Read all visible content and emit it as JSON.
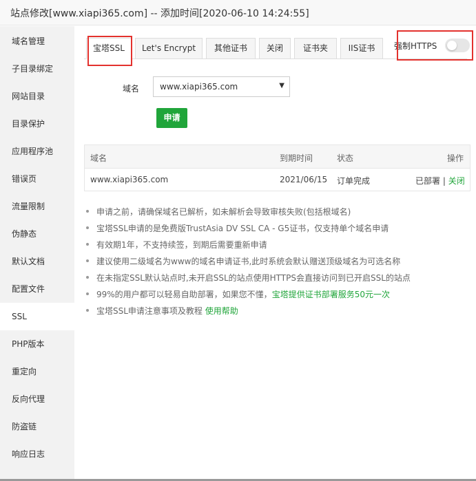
{
  "window": {
    "title": "站点修改[www.xiapi365.com] -- 添加时间[2020-06-10 14:24:55]"
  },
  "sidebar": {
    "items": [
      {
        "label": "域名管理"
      },
      {
        "label": "子目录绑定"
      },
      {
        "label": "网站目录"
      },
      {
        "label": "目录保护"
      },
      {
        "label": "应用程序池"
      },
      {
        "label": "错误页"
      },
      {
        "label": "流量限制"
      },
      {
        "label": "伪静态"
      },
      {
        "label": "默认文档"
      },
      {
        "label": "配置文件"
      },
      {
        "label": "SSL"
      },
      {
        "label": "PHP版本"
      },
      {
        "label": "重定向"
      },
      {
        "label": "反向代理"
      },
      {
        "label": "防盗链"
      },
      {
        "label": "响应日志"
      }
    ],
    "active_index": 10
  },
  "tabs": [
    {
      "label": "宝塔SSL",
      "active": true
    },
    {
      "label": "Let's Encrypt"
    },
    {
      "label": "其他证书"
    },
    {
      "label": "关闭"
    },
    {
      "label": "证书夹"
    },
    {
      "label": "IIS证书"
    }
  ],
  "force_https": {
    "label": "强制HTTPS",
    "enabled": false
  },
  "form": {
    "domain_label": "域名",
    "domain_value": "www.xiapi365.com",
    "domain_caret": "▼",
    "apply_label": "申请"
  },
  "table": {
    "headers": [
      "域名",
      "到期时间",
      "状态",
      "操作"
    ],
    "rows": [
      {
        "domain": "www.xiapi365.com",
        "expiry": "2021/06/15",
        "status": "订单完成",
        "action_deployed": "已部署",
        "action_sep": " | ",
        "action_close": "关闭"
      }
    ]
  },
  "tips": [
    {
      "text": "申请之前，请确保域名已解析，如未解析会导致审核失败(包括根域名)"
    },
    {
      "text": "宝塔SSL申请的是免费版TrustAsia DV SSL CA - G5证书，仅支持单个域名申请"
    },
    {
      "text": "有效期1年，不支持续签，到期后需要重新申请"
    },
    {
      "text": "建议使用二级域名为www的域名申请证书,此时系统会默认赠送顶级域名为可选名称"
    },
    {
      "text": "在未指定SSL默认站点时,未开启SSL的站点使用HTTPS会直接访问到已开启SSL的站点"
    },
    {
      "text": "99%的用户都可以轻易自助部署，如果您不懂，",
      "link": "宝塔提供证书部署服务50元一次"
    },
    {
      "text": "宝塔SSL申请注意事项及教程 ",
      "link": "使用帮助"
    }
  ],
  "colors": {
    "accent_green": "#20a53a",
    "highlight_red": "#e3312d"
  }
}
